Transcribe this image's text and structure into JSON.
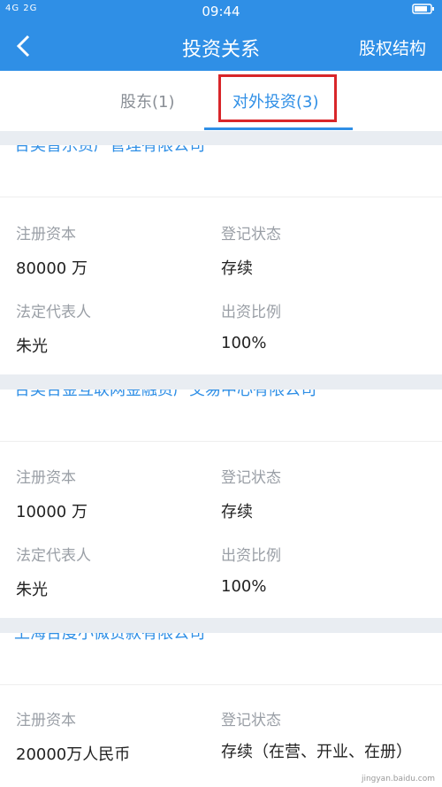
{
  "status_bar": {
    "signal_text": "4G 2G",
    "time": "09:44"
  },
  "header": {
    "title": "投资关系",
    "right_action": "股权结构"
  },
  "tabs": [
    {
      "label": "股东(1)",
      "active": false
    },
    {
      "label": "对外投资(3)",
      "active": true
    }
  ],
  "labels": {
    "registered_capital": "注册资本",
    "registration_status": "登记状态",
    "legal_representative": "法定代表人",
    "investment_ratio": "出资比例"
  },
  "investments": [
    {
      "company": "合美普乐资产管理有限公司",
      "registered_capital": "80000 万",
      "status": "存续",
      "legal_rep": "朱光",
      "ratio": "100%"
    },
    {
      "company": "合美合金互联网金融资产交易中心有限公司",
      "registered_capital": "10000 万",
      "status": "存续",
      "legal_rep": "朱光",
      "ratio": "100%"
    },
    {
      "company": "上海合度小微贷款有限公司",
      "registered_capital": "20000万人民币",
      "status": "存续（在营、开业、在册）"
    }
  ],
  "watermark": "jingyan.baidu.com",
  "colors": {
    "primary": "#2f8fe6",
    "highlight_box": "#d8262a",
    "page_bg": "#e9edf2"
  }
}
